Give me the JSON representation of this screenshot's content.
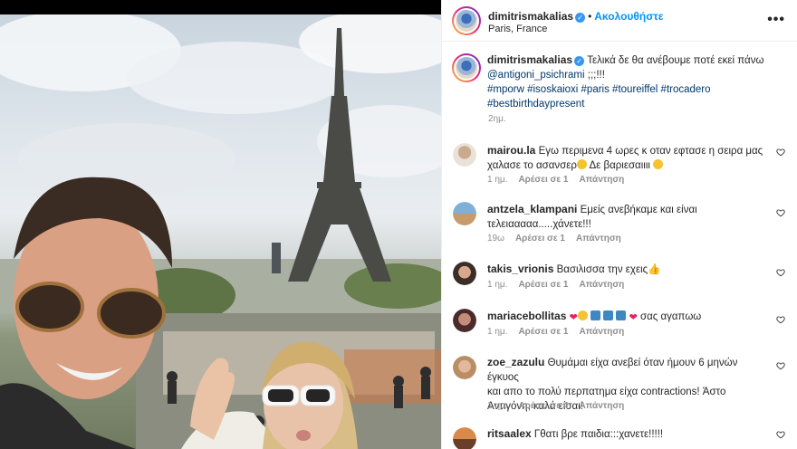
{
  "post": {
    "username": "dimitrismakalias",
    "follow_label": "Ακολουθήστε",
    "location": "Paris, France",
    "caption_prefix": "Τελικά δε θα ανέβουμε ποτέ εκεί πάνω",
    "caption_mention": "@antigoni_psichrami",
    "caption_suffix": ";;;!!!",
    "hashtags_line1": "#mporw #isoskaioxi #paris #toureiffel #trocadero",
    "hashtags_line2": "#bestbirthdaypresent",
    "time": "2ημ."
  },
  "comments": [
    {
      "username": "mairou.la",
      "text_line1": "Εγω περιμενα 4 ωρες κ οταν εφτασε η σειρα μας",
      "text_line2": "χαλασε το ασανσερ",
      "text_line2_after": "Δε βαριεσαιιιι",
      "time": "1 ημ.",
      "likes": "Αρέσει σε 1",
      "reply": "Απάντηση"
    },
    {
      "username": "antzela_klampani",
      "text_line1": "Εμείς ανεβήκαμε και είναι",
      "text_line2": "τελειααααα.....χάνετε!!!",
      "time": "19ω",
      "likes": "Αρέσει σε 1",
      "reply": "Απάντηση"
    },
    {
      "username": "takis_vrionis",
      "text_line1": "Βασιλισσα την εχεις",
      "time": "1 ημ.",
      "likes": "Αρέσει σε 1",
      "reply": "Απάντηση"
    },
    {
      "username": "mariacebollitas",
      "text_line1": "σας αγαπωω",
      "time": "1 ημ.",
      "likes": "Αρέσει σε 1",
      "reply": "Απάντηση"
    },
    {
      "username": "zoe_zazulu",
      "text_line1": "Θυμάμαι είχα ανεβεί όταν ήμουν 6 μηνών έγκυος",
      "text_line2": "και απο το πολύ περπατημα είχα contractions! Άστο",
      "text_line3": "Αντιγόνη, καλά είσαι!",
      "time": "1 ημ.",
      "likes": "Αρέσει σε 4",
      "reply": "Απάντηση"
    },
    {
      "username": "ritsaalex",
      "text_line1": "Γθατι βρε παιδια:::χανετε!!!!!"
    }
  ],
  "colors": {
    "link": "#0095f6",
    "hashtag": "#00376b",
    "muted": "#8e8e8e",
    "text": "#262626"
  },
  "icons": {
    "verified": "verified-badge-icon",
    "more": "more-options-icon",
    "like": "heart-outline-icon"
  }
}
